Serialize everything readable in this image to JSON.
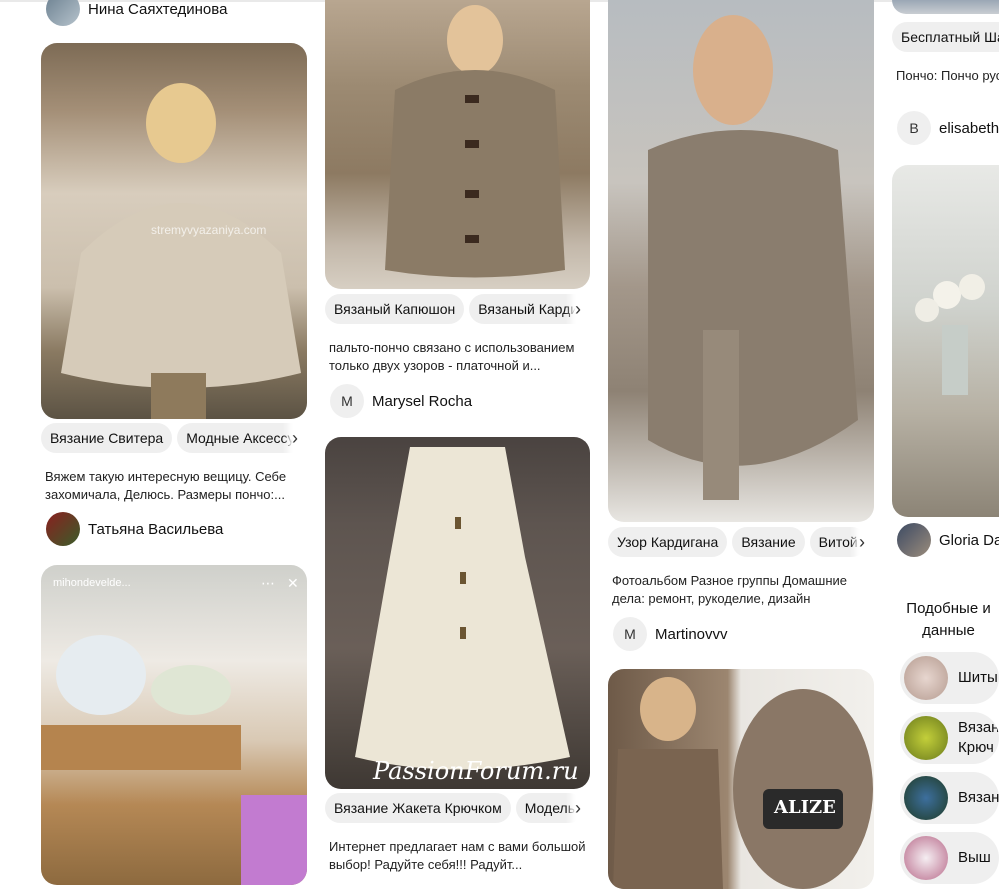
{
  "top_author": {
    "name": "Нина Саяхтединова"
  },
  "pins": [
    {
      "chips": [
        "Вязание Свитера",
        "Модные Аксессуары"
      ],
      "description": "Вяжем такую интересную вещицу. Себе захомичала, Делюсь. Размеры пончо:...",
      "author": "Татьяна Васильева",
      "image_text": "stremyvyazaniya.com"
    },
    {
      "chips": [
        "Вязаный Капюшон",
        "Вязаный Кардиган"
      ],
      "description": "пальто-пончо связано с использованием только двух узоров - платочной и...",
      "author_initial": "M",
      "author": "Marysel Rocha"
    },
    {
      "chips": [
        "Вязание Жакета Крючком",
        "Модель"
      ],
      "description": "Интернет предлагает нам с вами большой выбор! Радуйте себя!!! Радуйт...",
      "image_text": "PassionForum.ru"
    },
    {
      "chips": [
        "Узор Кардигана",
        "Вязание",
        "Витой"
      ],
      "description": "Фотоальбом Разное группы Домашние дела: ремонт, рукоделие, дизайн",
      "author_initial": "M",
      "author": "Martinovvv"
    },
    {
      "image_text": "ALIZE"
    },
    {
      "chips": [
        "Бесплатный Шаблон"
      ],
      "description": "Пончо: Пончо русский размеры. в интернете",
      "author_initial": "B",
      "author": "elisabeth"
    },
    {
      "author": "Gloria Da"
    }
  ],
  "bottom_left_pin": {
    "overlay_user": "mihondevelde..."
  },
  "similar": {
    "title": "Подобные и данные",
    "items": [
      {
        "label": "Шиты"
      },
      {
        "label": "Вязан Крюч"
      },
      {
        "label": "Вязан"
      },
      {
        "label": "Выш"
      }
    ]
  },
  "icons": {
    "chevron": "›",
    "close": "✕",
    "more": "⋯"
  }
}
